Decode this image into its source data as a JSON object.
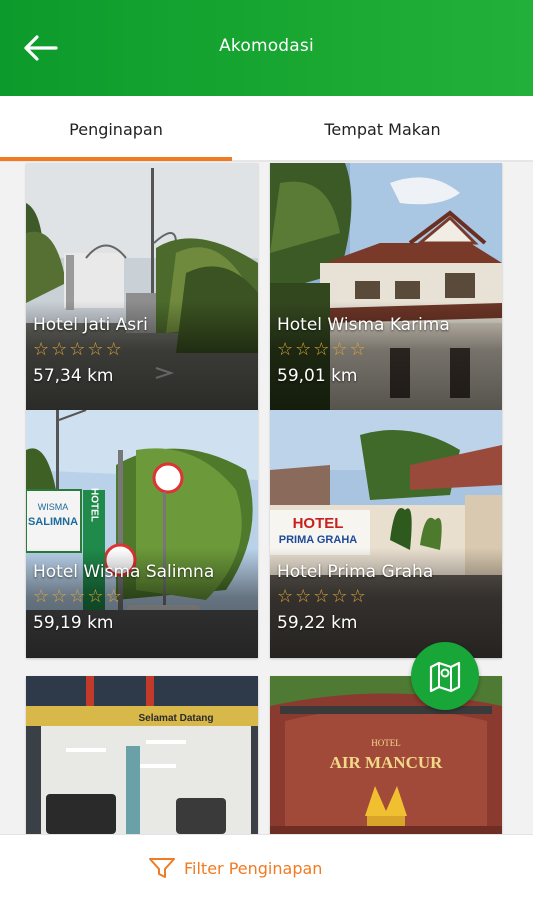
{
  "header": {
    "title": "Akomodasi",
    "back_icon": "arrow-left-icon"
  },
  "tabs": [
    {
      "label": "Penginapan",
      "active": true
    },
    {
      "label": "Tempat Makan",
      "active": false
    }
  ],
  "colors": {
    "accent": "#f07b22",
    "brand_green": "#17a637",
    "star": "#d9a43a"
  },
  "listings": [
    {
      "name": "Hotel Jati Asri",
      "distance": "57,34 km",
      "rating": 0
    },
    {
      "name": "Hotel Wisma Karima",
      "distance": "59,01 km",
      "rating": 0
    },
    {
      "name": "Hotel Wisma Salimna",
      "distance": "59,19 km",
      "rating": 0
    },
    {
      "name": "Hotel Prima Graha",
      "distance": "59,22 km",
      "rating": 0
    },
    {
      "name": "",
      "distance": "",
      "rating": 0
    },
    {
      "name": "",
      "distance": "",
      "rating": 0
    }
  ],
  "photo_signs": {
    "salimna_sign_1": "WISMA",
    "salimna_sign_2": "SALIMNA",
    "salimna_vertical": "HOTEL",
    "prima_1": "HOTEL",
    "prima_2": "PRIMA GRAHA",
    "parking_banner": "Selamat Datang",
    "air_top": "HOTEL",
    "air_name": "AIR MANCUR"
  },
  "fab": {
    "icon": "map-icon"
  },
  "filter": {
    "label": "Filter Penginapan",
    "icon": "funnel-icon"
  }
}
